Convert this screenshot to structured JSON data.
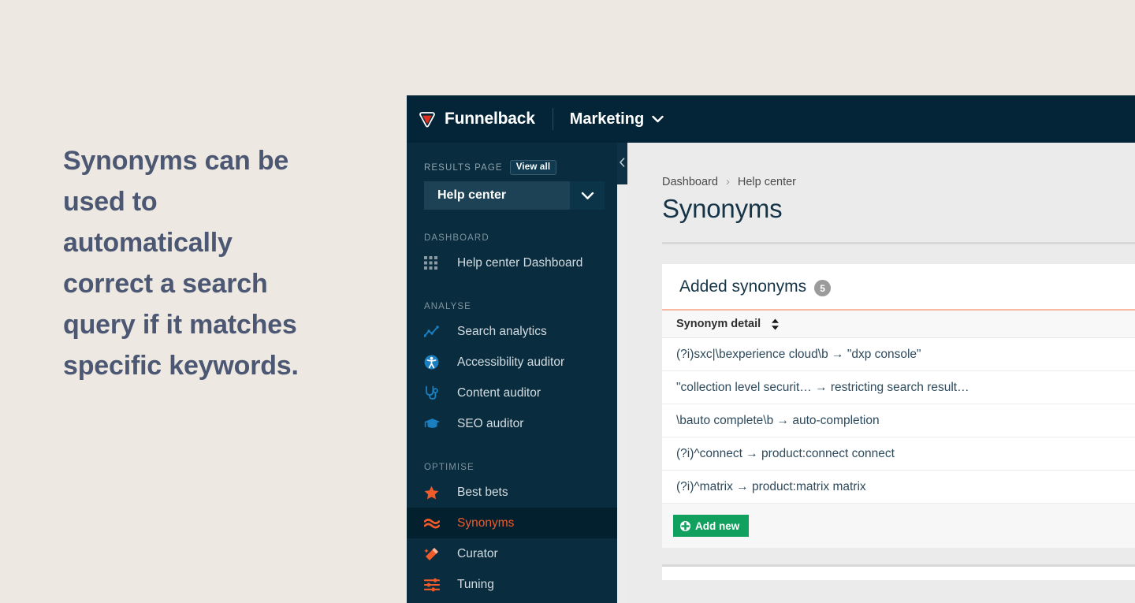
{
  "caption": {
    "text": "Synonyms can be used to automatically correct a search query if it matches specific keywords."
  },
  "colors": {
    "page_background": "#ede8e1",
    "header_navy": "#032537",
    "sidebar_navy": "#092c3e",
    "sidebar_active": "#03202e",
    "accent_orange": "#f15a29",
    "accent_green": "#12a05e",
    "accent_blue": "#1a7fc1",
    "card_rule_salmon": "#f6b9a3",
    "caption_text": "#4c5873"
  },
  "topbar": {
    "logo_icon": "funnelback-logo-icon",
    "brand": "Funnelback",
    "collection": "Marketing",
    "collection_caret_icon": "chevron-down-icon"
  },
  "sidebar": {
    "results_page": {
      "label": "RESULTS PAGE",
      "view_all_label": "View all",
      "selected": "Help center",
      "caret_icon": "chevron-down-icon"
    },
    "groups": [
      {
        "title": "DASHBOARD",
        "items": [
          {
            "label": "Help center Dashboard",
            "icon": "grid-icon",
            "active": false
          }
        ]
      },
      {
        "title": "ANALYSE",
        "items": [
          {
            "label": "Search analytics",
            "icon": "line-chart-icon",
            "active": false
          },
          {
            "label": "Accessibility auditor",
            "icon": "accessibility-icon",
            "active": false
          },
          {
            "label": "Content auditor",
            "icon": "stethoscope-icon",
            "active": false
          },
          {
            "label": "SEO auditor",
            "icon": "graduation-cap-icon",
            "active": false
          }
        ]
      },
      {
        "title": "OPTIMISE",
        "items": [
          {
            "label": "Best bets",
            "icon": "star-icon",
            "active": false
          },
          {
            "label": "Synonyms",
            "icon": "wave-icon",
            "active": true
          },
          {
            "label": "Curator",
            "icon": "magic-wand-icon",
            "active": false
          },
          {
            "label": "Tuning",
            "icon": "sliders-icon",
            "active": false
          }
        ]
      }
    ],
    "collapse_icon": "chevron-left-icon"
  },
  "main": {
    "breadcrumb": {
      "items": [
        "Dashboard",
        "Help center"
      ],
      "separator": "›"
    },
    "page_title": "Synonyms",
    "card": {
      "title": "Added synonyms",
      "count": "5",
      "table": {
        "column_header": "Synonym detail",
        "sort_icon": "sort-updown-icon",
        "rows": [
          "(?i)sxc|\\bexperience cloud\\b → \"dxp console\"",
          "\"collection level securit… → restricting search result…",
          "\\bauto complete\\b → auto-completion",
          "(?i)^connect → product:connect connect",
          "(?i)^matrix → product:matrix matrix"
        ]
      },
      "add_new_label": "Add new",
      "add_new_icon": "plus-circle-icon"
    }
  }
}
